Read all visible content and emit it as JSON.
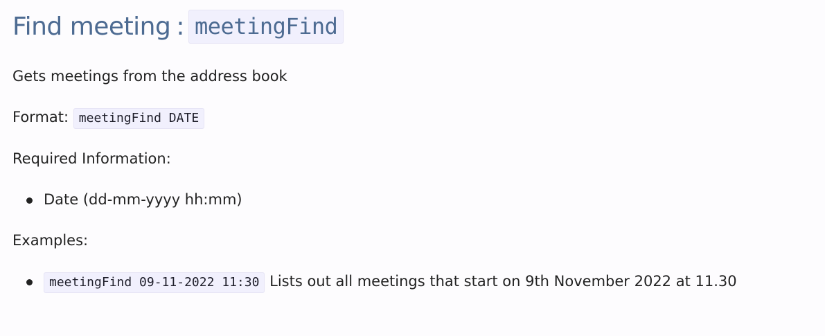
{
  "heading": {
    "text": "Find meeting",
    "separator": ":",
    "command": "meetingFind"
  },
  "description": "Gets meetings from the address book",
  "format": {
    "label": "Format:",
    "code": "meetingFind DATE"
  },
  "required": {
    "label": "Required Information:",
    "items": [
      {
        "text": "Date (dd-mm-yyyy hh:mm)"
      }
    ]
  },
  "examples": {
    "label": "Examples:",
    "items": [
      {
        "code": "meetingFind 09-11-2022 11:30",
        "text": "Lists out all meetings that start on 9th November 2022 at 11.30"
      }
    ]
  },
  "colors": {
    "heading": "#4d6b92",
    "code_background": "#f1f0fd",
    "text": "#222222",
    "background": "#fdfcfe"
  }
}
